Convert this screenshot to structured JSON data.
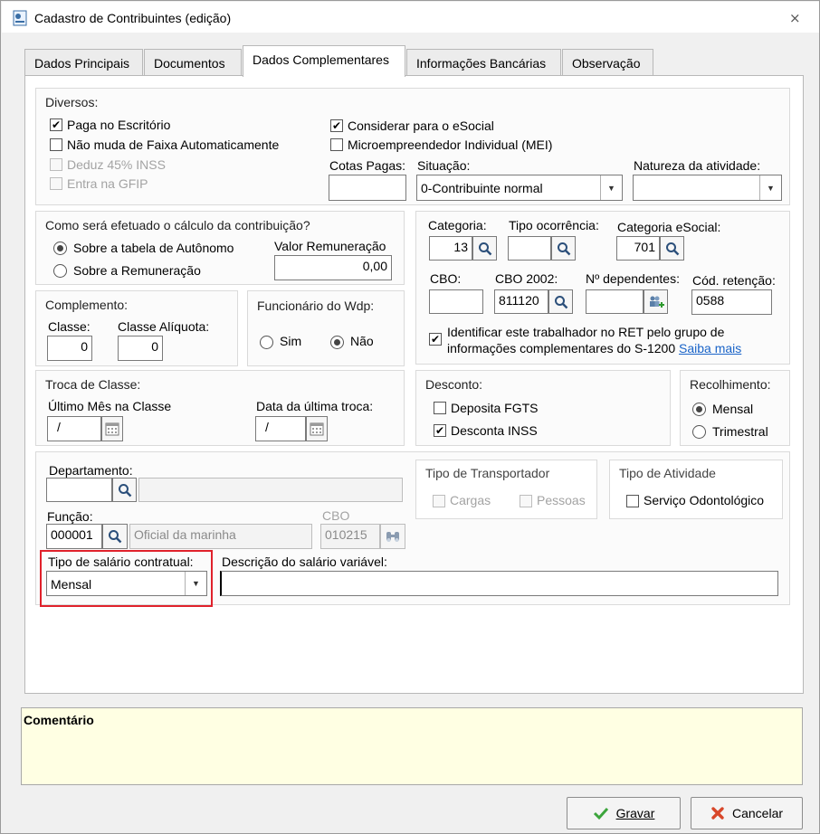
{
  "window": {
    "title": "Cadastro de Contribuintes (edição)",
    "close_glyph": "⨯"
  },
  "tabs": [
    {
      "label": "Dados Principais"
    },
    {
      "label": "Documentos"
    },
    {
      "label": "Dados Complementares"
    },
    {
      "label": "Informações Bancárias"
    },
    {
      "label": "Observação"
    }
  ],
  "diversos": {
    "title": "Diversos:",
    "paga_escritorio": "Paga no Escritório",
    "nao_muda_faixa": "Não muda de Faixa Automaticamente",
    "deduz_inss": "Deduz 45% INSS",
    "entra_gfip": "Entra na GFIP",
    "considerar_esocial": "Considerar para o eSocial",
    "mei": "Microempreendedor Individual (MEI)",
    "cotas_label": "Cotas Pagas:",
    "cotas_value": "",
    "situacao_label": "Situação:",
    "situacao_value": "0-Contribuinte normal",
    "natureza_label": "Natureza da atividade:",
    "natureza_value": ""
  },
  "calculo": {
    "title": "Como será efetuado o cálculo da contribuição?",
    "opt_tabela": "Sobre a tabela de Autônomo",
    "opt_remuneracao": "Sobre a Remuneração",
    "valor_label": "Valor Remuneração",
    "valor": "0,00"
  },
  "categoria": {
    "categoria_label": "Categoria:",
    "categoria_value": "13",
    "tipo_ocorrencia_label": "Tipo ocorrência:",
    "tipo_ocorrencia_value": "",
    "cat_esocial_label": "Categoria eSocial:",
    "cat_esocial_value": "701",
    "cbo_label": "CBO:",
    "cbo_value": "",
    "cbo2002_label": "CBO 2002:",
    "cbo2002_value": "811120",
    "dependentes_label": "Nº dependentes:",
    "dependentes_value": "",
    "retencao_label": "Cód. retenção:",
    "retencao_value": "0588",
    "ret_line1": "Identificar este trabalhador no RET pelo grupo de",
    "ret_line2": "informações complementares do S-1200",
    "saiba_mais": "Saiba mais"
  },
  "complemento": {
    "title": "Complemento:",
    "classe_label": "Classe:",
    "classe_value": "0",
    "aliquota_label": "Classe Alíquota:",
    "aliquota_value": "0"
  },
  "funcionario": {
    "title": "Funcionário do Wdp:",
    "sim": "Sim",
    "nao": "Não"
  },
  "troca": {
    "title": "Troca de Classe:",
    "ultimo_label": "Último Mês na Classe",
    "ultimo_value": "/",
    "data_label": "Data da última troca:",
    "data_value": "/"
  },
  "desconto": {
    "title": "Desconto:",
    "fgts": "Deposita FGTS",
    "inss": "Desconta INSS"
  },
  "recolhimento": {
    "title": "Recolhimento:",
    "mensal": "Mensal",
    "trimestral": "Trimestral"
  },
  "departamento": {
    "dep_label": "Departamento:",
    "dep_code": "",
    "dep_name": "",
    "funcao_label": "Função:",
    "funcao_code": "000001",
    "funcao_name": "Oficial da marinha",
    "cbo_label": "CBO",
    "cbo_value": "010215",
    "tipo_salario_label": "Tipo de salário contratual:",
    "tipo_salario_value": "Mensal",
    "desc_salario_label": "Descrição do salário variável:",
    "desc_salario_value": ""
  },
  "transportador": {
    "title": "Tipo de Transportador",
    "cargas": "Cargas",
    "pessoas": "Pessoas"
  },
  "atividade": {
    "title": "Tipo de Atividade",
    "odontologico": "Serviço Odontológico"
  },
  "comentario": {
    "label": "Comentário"
  },
  "actions": {
    "gravar": "Gravar",
    "cancelar": "Cancelar"
  },
  "colors": {
    "highlight": "#e0212b",
    "comment_bg": "#ffffe3",
    "link": "#1a64c8"
  }
}
